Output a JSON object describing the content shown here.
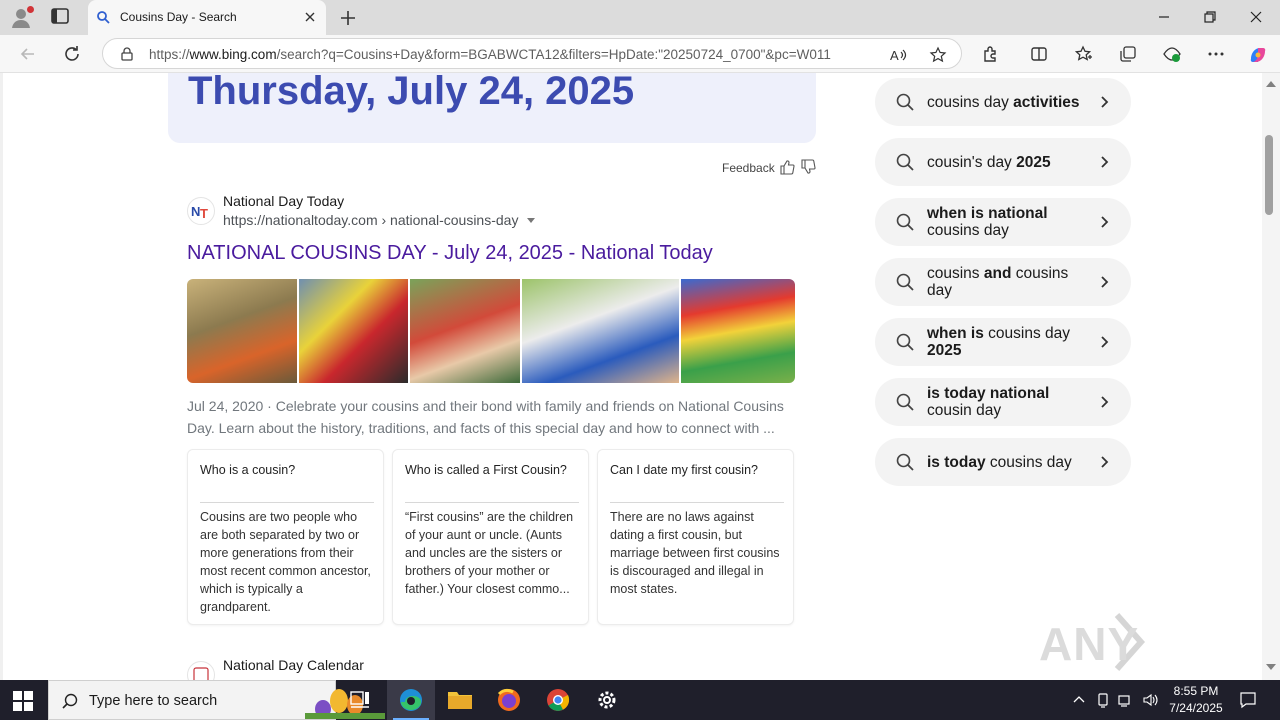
{
  "browser": {
    "tab_title": "Cousins Day - Search",
    "url_prefix": "https://",
    "url_host": "www.bing.com",
    "url_rest": "/search?q=Cousins+Day&form=BGABWCTA12&filters=HpDate:\"20250724_0700\"&pc=W011"
  },
  "page": {
    "date_heading": "Thursday, July 24, 2025",
    "feedback_label": "Feedback",
    "result1": {
      "site_name": "National Day Today",
      "site_url": "https://nationaltoday.com › national-cousins-day",
      "title": "NATIONAL COUSINS DAY - July 24, 2025 - National Today",
      "snippet": "Jul 24, 2020 · Celebrate your cousins and their bond with family and friends on National Cousins Day. Learn about the history, traditions, and facts of this special day and how to connect with ...",
      "qa": [
        {
          "question": "Who is a cousin?",
          "answer": "Cousins are two people who are both separated by two or more generations from their most recent common ancestor, which is typically a grandparent."
        },
        {
          "question": "Who is called a First Cousin?",
          "answer": "“First cousins” are the children of your aunt or uncle. (Aunts and uncles are the sisters or brothers of your mother or father.) Your closest commo..."
        },
        {
          "question": "Can I date my first cousin?",
          "answer": "There are no laws against dating a first cousin, but marriage between first cousins is discouraged and illegal in most states."
        }
      ]
    },
    "result2": {
      "site_name": "National Day Calendar"
    },
    "related_searches": [
      {
        "normal": "cousins day ",
        "bold": "activities",
        "order": "nb"
      },
      {
        "normal": "cousin's day ",
        "bold": "2025",
        "order": "nb"
      },
      {
        "bold": "when is national",
        "normal": " cousins day",
        "order": "bn"
      },
      {
        "normal": "cousins ",
        "bold": "and",
        "normal2": " cousins day",
        "order": "nbn"
      },
      {
        "bold": "when is",
        "normal": " cousins day ",
        "bold2": "2025",
        "order": "bnb"
      },
      {
        "bold": "is today national",
        "normal": " cousin day",
        "order": "bn"
      },
      {
        "bold": "is today",
        "normal": " cousins day",
        "order": "bn"
      }
    ]
  },
  "taskbar": {
    "search_placeholder": "Type here to search",
    "time": "8:55 PM",
    "date": "7/24/2025"
  },
  "watermark": "ANY RUN",
  "colors": {
    "title_link": "#4a1b9e",
    "date_heading": "#3c4bb0",
    "date_card_bg": "#eef0fb",
    "taskbar_bg": "#1f1f2b"
  }
}
